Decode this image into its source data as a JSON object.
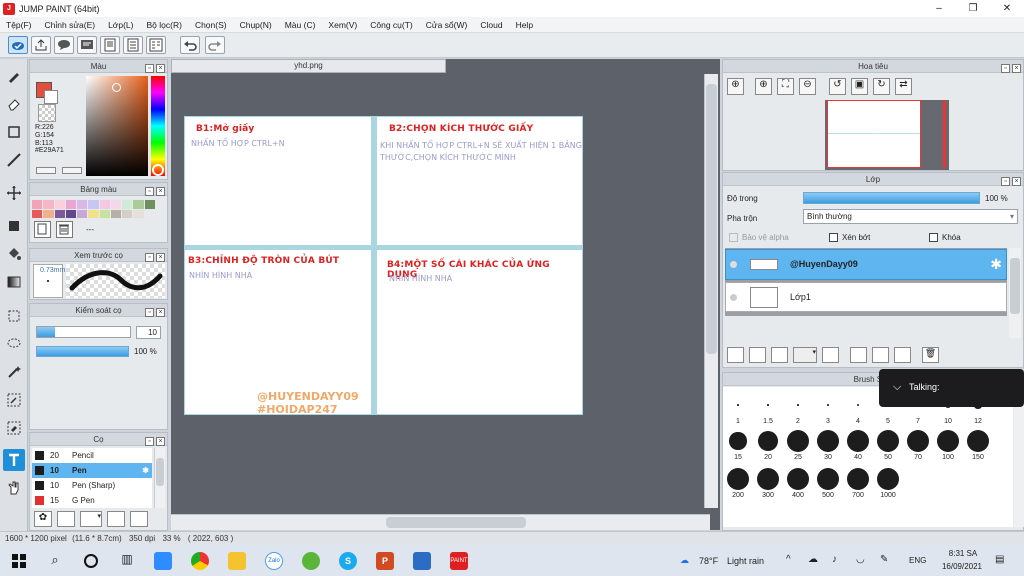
{
  "window": {
    "title": "JUMP PAINT (64bit)",
    "controls": [
      "–",
      "❐",
      "✕"
    ]
  },
  "menu": [
    "Tệp(F)",
    "Chỉnh sửa(E)",
    "Lớp(L)",
    "Bộ lọc(R)",
    "Chọn(S)",
    "Chụp(N)",
    "Màu (C)",
    "Xem(V)",
    "Công cụ(T)",
    "Cửa sổ(W)",
    "Cloud",
    "Help"
  ],
  "color_panel": {
    "title": "Màu",
    "r": "R:226",
    "g": "G:154",
    "b": "B:113",
    "hex": "#E29A71",
    "fg_color": "#e2503d"
  },
  "swatch_panel": {
    "title": "Bảng màu",
    "label": "---"
  },
  "preview_panel": {
    "title": "Xem trước cọ",
    "size": "0.73mm"
  },
  "control_panel": {
    "title": "Kiểm soát cọ",
    "size_value": "10",
    "opacity_value": "100 %"
  },
  "brush_panel": {
    "title": "Cọ",
    "items": [
      {
        "size": "20",
        "name": "Pencil",
        "color": "#1d1d1d"
      },
      {
        "size": "10",
        "name": "Pen",
        "color": "#1d1d1d",
        "selected": true
      },
      {
        "size": "10",
        "name": "Pen (Sharp)",
        "color": "#1d1d1d"
      },
      {
        "size": "15",
        "name": "G Pen",
        "color": "#e23030"
      }
    ]
  },
  "document": {
    "tab": "yhd.png",
    "cells": [
      {
        "heading": "B1:Mở giấy",
        "body": "NHẤN TỔ HỢP CTRL+N"
      },
      {
        "heading": "B2:CHỌN KÍCH THƯỚC GIẤY",
        "body": "KHI NHẤN TỔ HỢP CTRL+N SẼ XUẤT HIỆN 1 BẢNG KÍCH THƯỚC,CHỌN KÍCH THƯỚC MÌNH"
      },
      {
        "heading": "B3:CHỈNH ĐỘ TRÒN CỦA BÚT",
        "body": "NHÌN HÌNH NHA"
      },
      {
        "heading": "B4:MỘT SỐ CÁI KHÁC CỦA ỨNG DỤNG",
        "body": "NHÌN HÌNH NHA"
      }
    ],
    "signature_1": "@HUYENDAYY09",
    "signature_2": "#HOIDAP247"
  },
  "navigator": {
    "title": "Hoa tiêu"
  },
  "layer_panel": {
    "title": "Lớp",
    "opacity_label": "Độ trong",
    "opacity_value": "100 %",
    "blend_label": "Pha trộn",
    "blend_value": "Bình thường",
    "protect_alpha": "Bảo vệ alpha",
    "clip": "Xén bớt",
    "lock": "Khóa",
    "layers": [
      {
        "name": "@HuyenDayy09",
        "selected": true
      },
      {
        "name": "Lớp1",
        "selected": false
      }
    ]
  },
  "brush_size_panel": {
    "title": "Brush Size",
    "row1": [
      "1",
      "1.5",
      "2",
      "3",
      "4",
      "5",
      "7",
      "10",
      "12"
    ],
    "row2": [
      "15",
      "20",
      "25",
      "30",
      "40",
      "50",
      "70",
      "100",
      "150"
    ],
    "row3": [
      "200",
      "300",
      "400",
      "500",
      "700",
      "1000"
    ]
  },
  "talking": "Talking:",
  "status": {
    "pixels": "1600 * 1200 pixel",
    "size": "(11.6 * 8.7cm)",
    "dpi": "350 dpi",
    "zoom": "33 %",
    "coords": "( 2022, 603 )"
  },
  "taskbar": {
    "weather_temp": "78°F",
    "weather_text": "Light rain",
    "lang": "ENG",
    "time": "8:31 SA",
    "date": "16/09/2021"
  }
}
